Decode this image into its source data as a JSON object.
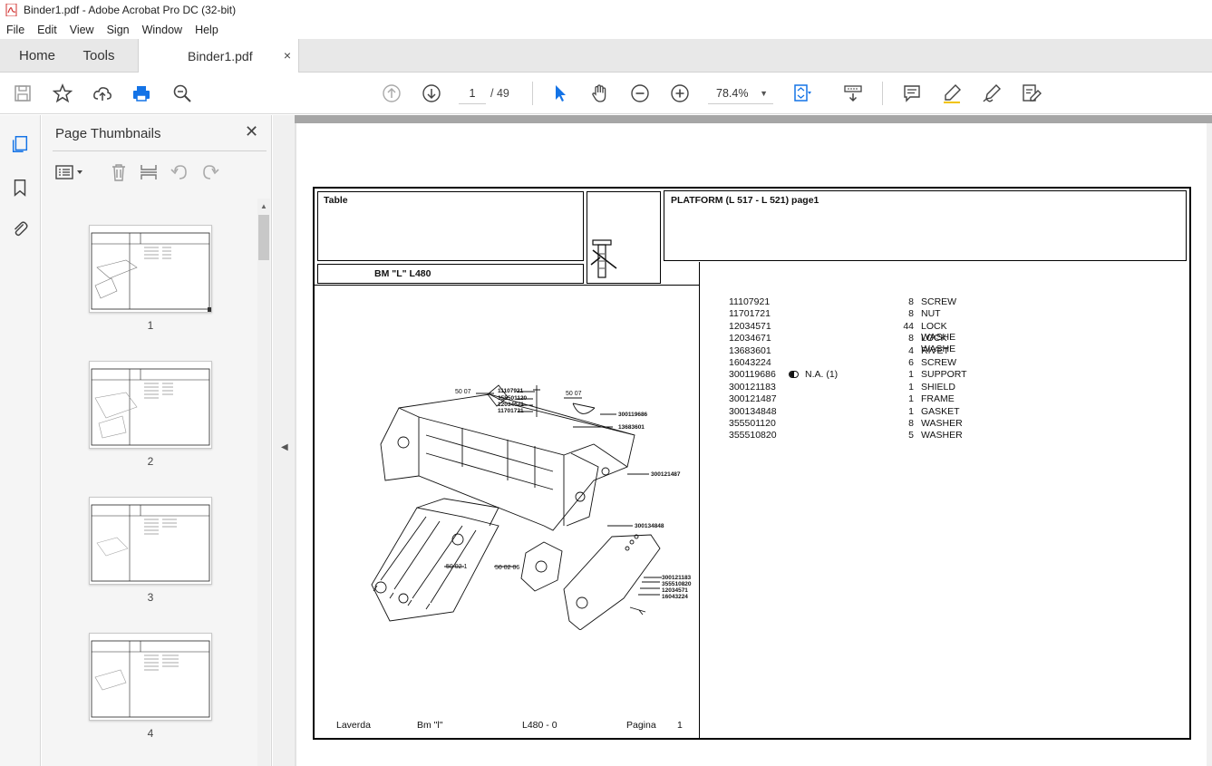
{
  "window": {
    "title": "Binder1.pdf - Adobe Acrobat Pro DC (32-bit)"
  },
  "menu": [
    "File",
    "Edit",
    "View",
    "Sign",
    "Window",
    "Help"
  ],
  "tabs": {
    "home": "Home",
    "tools": "Tools",
    "document": "Binder1.pdf",
    "close": "×"
  },
  "toolbar": {
    "page_current": "1",
    "page_total": "/ 49",
    "zoom": "78.4%"
  },
  "panel": {
    "title": "Page Thumbnails",
    "close": "✕",
    "thumbnails": [
      {
        "label": "1"
      },
      {
        "label": "2"
      },
      {
        "label": "3"
      },
      {
        "label": "4"
      }
    ]
  },
  "document": {
    "table_label": "Table",
    "model_label": "BM \"L\"  L480",
    "section_title": "PLATFORM (L 517 - L 521)  page1",
    "footer": {
      "brand": "Laverda",
      "model": "Bm \"l\"",
      "code": "L480 - 0",
      "page_label": "Pagina",
      "page_number": "1"
    },
    "parts": [
      {
        "number": "11107921",
        "note": "",
        "qty": "8",
        "desc": "SCREW"
      },
      {
        "number": "11701721",
        "note": "",
        "qty": "8",
        "desc": "NUT"
      },
      {
        "number": "12034571",
        "note": "",
        "qty": "44",
        "desc": "LOCK WASHE"
      },
      {
        "number": "12034671",
        "note": "",
        "qty": "8",
        "desc": "LOCK WASHE"
      },
      {
        "number": "13683601",
        "note": "",
        "qty": "4",
        "desc": "RIVET"
      },
      {
        "number": "16043224",
        "note": "",
        "qty": "6",
        "desc": "SCREW"
      },
      {
        "number": "300119686",
        "note": "N.A.  (1)",
        "qty": "1",
        "desc": "SUPPORT"
      },
      {
        "number": "300121183",
        "note": "",
        "qty": "1",
        "desc": "SHIELD"
      },
      {
        "number": "300121487",
        "note": "",
        "qty": "1",
        "desc": "FRAME"
      },
      {
        "number": "300134848",
        "note": "",
        "qty": "1",
        "desc": "GASKET"
      },
      {
        "number": "355501120",
        "note": "",
        "qty": "8",
        "desc": "WASHER"
      },
      {
        "number": "355510820",
        "note": "",
        "qty": "5",
        "desc": "WASHER"
      }
    ],
    "diagram_labels": {
      "ref_5007a": "50 07",
      "ref_5007b": "50 07",
      "ref_50021": "50 02 1",
      "ref_500206": "50 02 06",
      "lbl_11107921": "11107921",
      "lbl_355501120": "355501120",
      "lbl_12034671": "12034671",
      "lbl_11701721": "11701721",
      "lbl_300119686": "300119686",
      "lbl_13683601": "13683601",
      "lbl_300121487": "300121487",
      "lbl_300134848": "300134848",
      "lbl_300121183": "300121183",
      "lbl_355510820": "355510820",
      "lbl_12034571": "12034571",
      "lbl_16043224": "16043224"
    }
  }
}
